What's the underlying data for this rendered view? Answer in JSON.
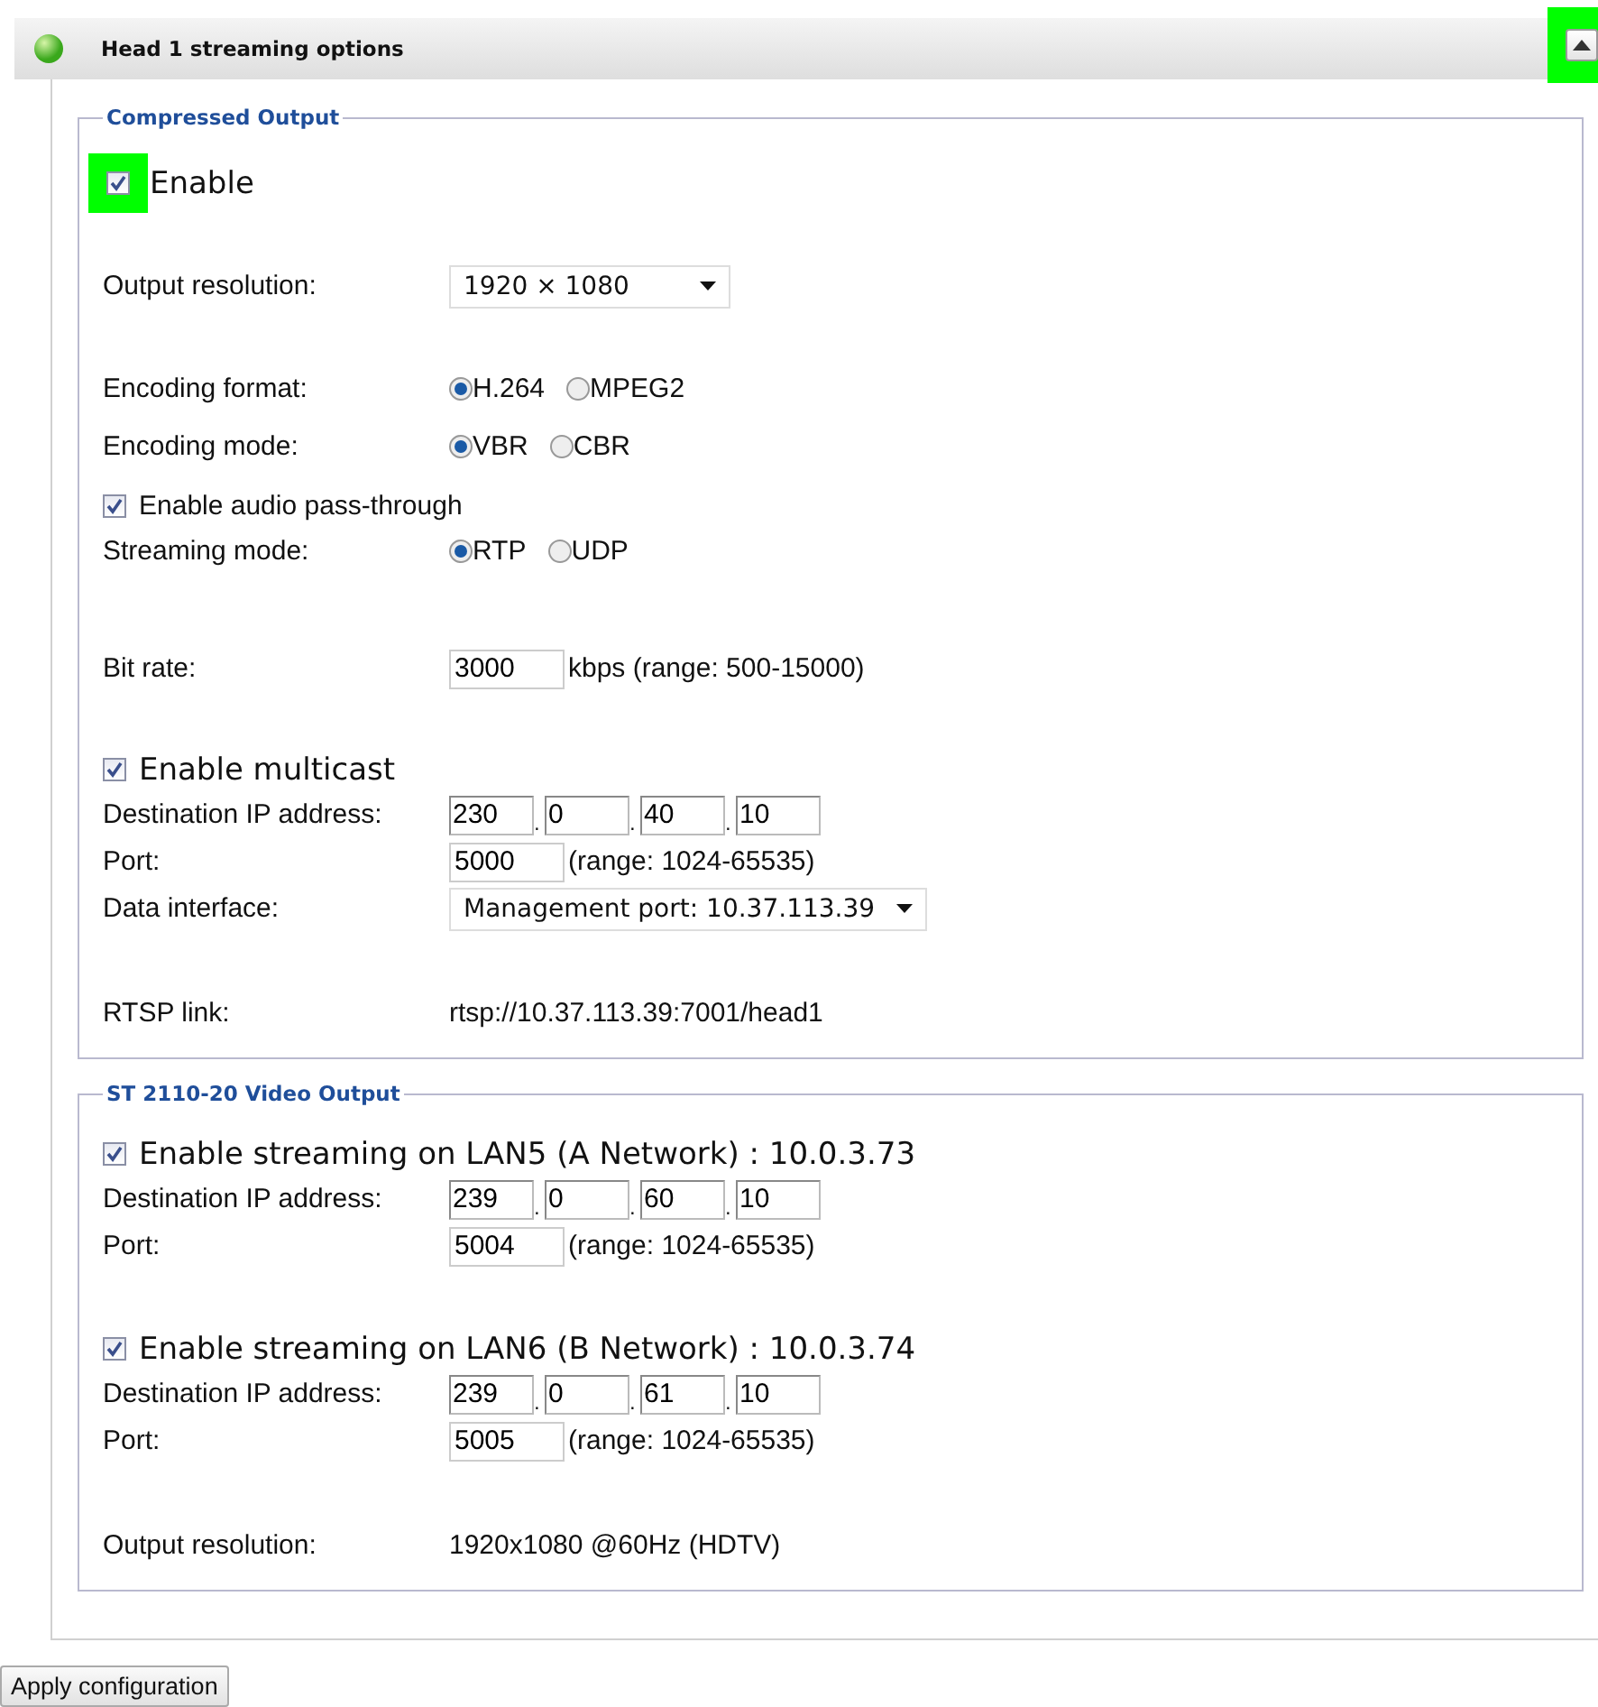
{
  "header": {
    "title": "Head 1 streaming options",
    "collapse_highlighted": true
  },
  "sections": [
    {
      "legend": "Compressed Output",
      "rows": [
        {
          "kind": "checkbox",
          "label": "Enable",
          "checked": true,
          "large": true,
          "highlighted": true
        },
        {
          "kind": "select",
          "label": "Output resolution:",
          "value": "1920 × 1080"
        },
        {
          "kind": "radio",
          "label": "Encoding format:",
          "options": [
            {
              "label": "H.264",
              "selected": true
            },
            {
              "label": "MPEG2",
              "selected": false
            }
          ]
        },
        {
          "kind": "radio",
          "label": "Encoding mode:",
          "options": [
            {
              "label": "VBR",
              "selected": true
            },
            {
              "label": "CBR",
              "selected": false
            }
          ]
        },
        {
          "kind": "checkbox",
          "label": "Enable audio pass-through",
          "checked": true,
          "large": false,
          "highlighted": false
        },
        {
          "kind": "radio",
          "label": "Streaming mode:",
          "options": [
            {
              "label": "RTP",
              "selected": true
            },
            {
              "label": "UDP",
              "selected": false
            }
          ]
        },
        {
          "kind": "number",
          "label": "Bit rate:",
          "value": "3000",
          "note": "kbps (range: 500-15000)"
        },
        {
          "kind": "checkbox",
          "label": "Enable multicast",
          "checked": true,
          "large": true,
          "highlighted": false
        },
        {
          "kind": "ip",
          "label": "Destination IP address:",
          "octets": [
            "230",
            "0",
            "40",
            "10"
          ],
          "separators": [
            ".",
            ".",
            "."
          ]
        },
        {
          "kind": "number",
          "label": "Port:",
          "value": "5000",
          "note": "(range: 1024-65535)"
        },
        {
          "kind": "select",
          "label": "Data interface:",
          "value": "Management port: 10.37.113.39"
        },
        {
          "kind": "text",
          "label": "RTSP link:",
          "value": "rtsp://10.37.113.39:7001/head1"
        }
      ]
    },
    {
      "legend": "ST 2110-20 Video Output",
      "rows": [
        {
          "kind": "checkbox",
          "label": "Enable streaming on LAN5 (A Network) : 10.0.3.73",
          "checked": true,
          "large": true,
          "highlighted": false
        },
        {
          "kind": "ip",
          "label": "Destination IP address:",
          "octets": [
            "239",
            "0",
            "60",
            "10"
          ],
          "separators": [
            ".",
            ".",
            "."
          ]
        },
        {
          "kind": "number",
          "label": "Port:",
          "value": "5004",
          "note": "(range: 1024-65535)"
        },
        {
          "kind": "checkbox",
          "label": "Enable streaming on LAN6 (B Network) : 10.0.3.74",
          "checked": true,
          "large": true,
          "highlighted": false
        },
        {
          "kind": "ip",
          "label": "Destination IP address:",
          "octets": [
            "239",
            "0",
            "61",
            "10"
          ],
          "separators": [
            ".",
            ".",
            "."
          ]
        },
        {
          "kind": "number",
          "label": "Port:",
          "value": "5005",
          "note": "(range: 1024-65535)"
        },
        {
          "kind": "text",
          "label": "Output resolution:",
          "value": "1920x1080 @60Hz (HDTV)"
        }
      ]
    }
  ],
  "apply_button": "Apply configuration"
}
